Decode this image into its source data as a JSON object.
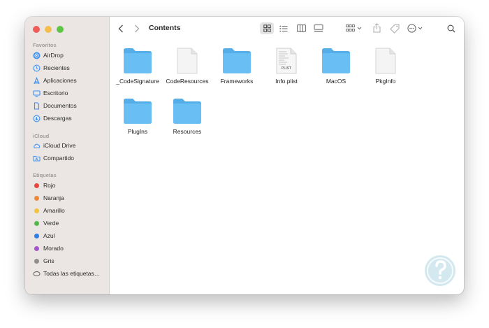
{
  "window": {
    "title": "Contents"
  },
  "sidebar": {
    "favorites_header": "Favoritos",
    "favorites": [
      {
        "label": "AirDrop",
        "icon": "airdrop-icon"
      },
      {
        "label": "Recientes",
        "icon": "clock-icon"
      },
      {
        "label": "Aplicaciones",
        "icon": "applications-icon"
      },
      {
        "label": "Escritorio",
        "icon": "desktop-icon"
      },
      {
        "label": "Documentos",
        "icon": "document-icon"
      },
      {
        "label": "Descargas",
        "icon": "download-icon"
      }
    ],
    "icloud_header": "iCloud",
    "icloud": [
      {
        "label": "iCloud Drive",
        "icon": "cloud-icon"
      },
      {
        "label": "Compartido",
        "icon": "shared-folder-icon"
      }
    ],
    "tags_header": "Etiquetas",
    "tags": [
      {
        "label": "Rojo",
        "color": "#e8473e"
      },
      {
        "label": "Naranja",
        "color": "#f0883a"
      },
      {
        "label": "Amarillo",
        "color": "#f2c33c"
      },
      {
        "label": "Verde",
        "color": "#55b948"
      },
      {
        "label": "Azul",
        "color": "#2f7fe5"
      },
      {
        "label": "Morado",
        "color": "#a357c8"
      },
      {
        "label": "Gris",
        "color": "#8e8e8e"
      },
      {
        "label": "Todas las etiquetas…",
        "color": "outline"
      }
    ]
  },
  "toolbar": {
    "buttons": [
      "back-icon",
      "forward-icon",
      "icon-view-icon",
      "list-view-icon",
      "column-view-icon",
      "gallery-view-icon",
      "group-icon",
      "share-icon",
      "tag-icon",
      "more-icon",
      "search-icon"
    ]
  },
  "files": [
    {
      "name": "_CodeSignature",
      "kind": "folder"
    },
    {
      "name": "CodeResources",
      "kind": "document"
    },
    {
      "name": "Frameworks",
      "kind": "folder"
    },
    {
      "name": "Info.plist",
      "kind": "plist",
      "badge": "PLIST"
    },
    {
      "name": "MacOS",
      "kind": "folder"
    },
    {
      "name": "PkgInfo",
      "kind": "document"
    },
    {
      "name": "PlugIns",
      "kind": "folder"
    },
    {
      "name": "Resources",
      "kind": "folder"
    }
  ],
  "colors": {
    "sidebar_bg": "#ebe6e3",
    "folder_blue": "#69bff3",
    "accent": "#3d8ff2",
    "traffic_red": "#ee5d57",
    "traffic_yellow": "#f4be4f",
    "traffic_green": "#5ec544"
  }
}
